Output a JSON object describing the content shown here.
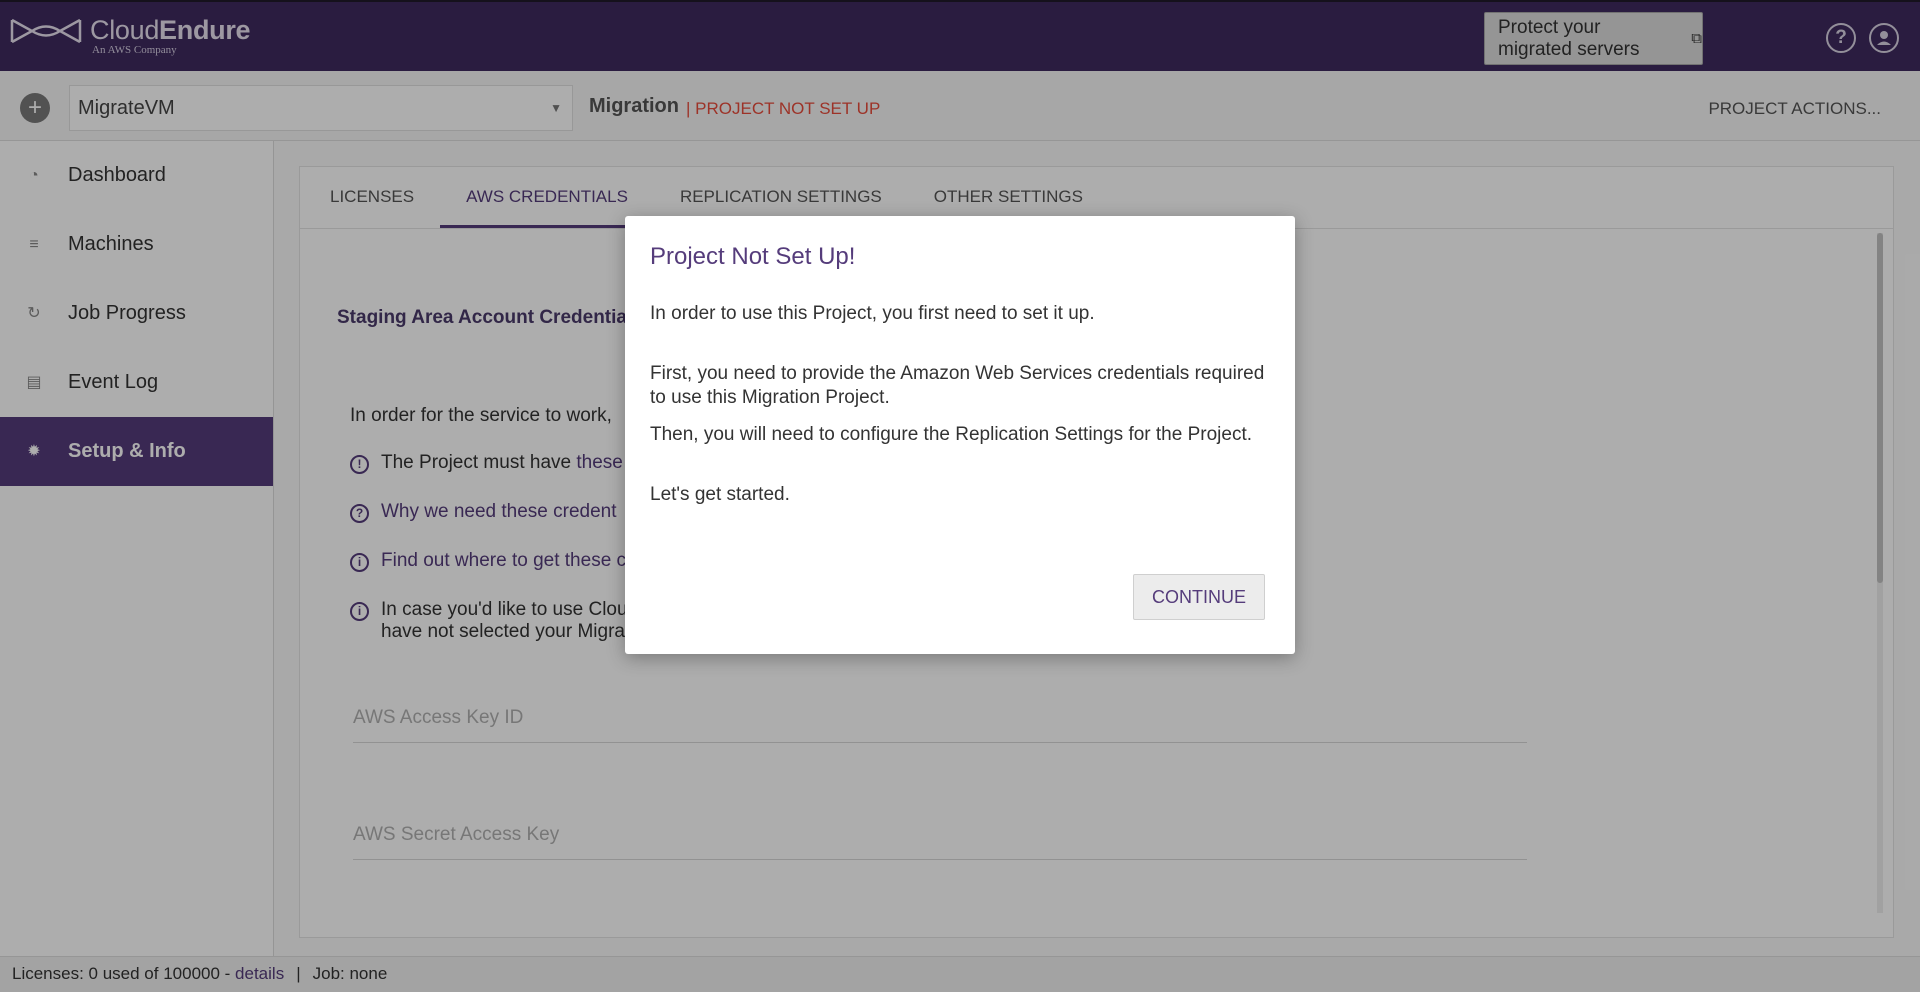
{
  "header": {
    "brand_name_regular": "Cloud",
    "brand_name_bold": "Endure",
    "brand_subtitle": "An AWS Company",
    "protect_button": "Protect your migrated servers",
    "icons": [
      "help-icon",
      "user-icon"
    ]
  },
  "project_bar": {
    "selected_project": "MigrateVM",
    "title": "Migration",
    "status": "| PROJECT NOT SET UP",
    "actions": "PROJECT ACTIONS..."
  },
  "sidebar": {
    "items": [
      {
        "label": "Dashboard",
        "icon": "dashboard-icon"
      },
      {
        "label": "Machines",
        "icon": "machines-icon"
      },
      {
        "label": "Job Progress",
        "icon": "job-progress-icon"
      },
      {
        "label": "Event Log",
        "icon": "event-log-icon"
      },
      {
        "label": "Setup & Info",
        "icon": "gear-icon",
        "active": true
      }
    ]
  },
  "tabs": [
    {
      "label": "LICENSES"
    },
    {
      "label": "AWS CREDENTIALS",
      "active": true
    },
    {
      "label": "REPLICATION SETTINGS"
    },
    {
      "label": "OTHER SETTINGS"
    }
  ],
  "content": {
    "section_title": "Staging Area Account Credentia",
    "intro": "In order for the service to work,",
    "info_lines": [
      {
        "text": "The Project must have ",
        "link": "these"
      },
      {
        "link": "Why we need these credent"
      },
      {
        "link": "Find out where to get these c"
      },
      {
        "text": "In case you'd like to use Clou",
        "text2": "have not selected your Migra"
      }
    ],
    "fields": {
      "access_key_placeholder": "AWS Access Key ID",
      "secret_key_placeholder": "AWS Secret Access Key"
    }
  },
  "footer": {
    "licenses": "Licenses:  0 used of 100000 - ",
    "details_link": "details",
    "separator": "|",
    "job": "Job:  none"
  },
  "modal": {
    "title": "Project Not Set Up!",
    "p1": "In order to use this Project, you first need to set it up.",
    "p2": "First, you need to provide the Amazon Web Services credentials required to use this Migration Project.",
    "p3": "Then, you will need to configure the Replication Settings for the Project.",
    "p4": "Let's get started.",
    "continue_label": "CONTINUE"
  },
  "colors": {
    "header_bg": "#3e2a5f",
    "accent": "#553c7b",
    "status_red": "#e74c3c"
  }
}
